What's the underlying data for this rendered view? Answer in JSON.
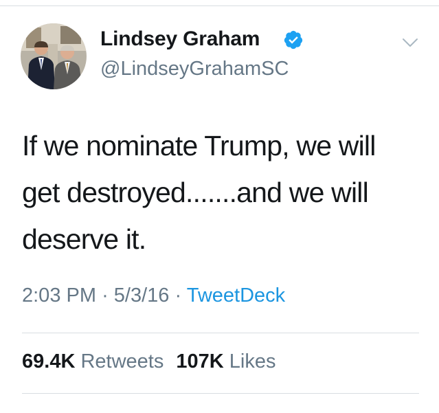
{
  "user": {
    "name": "Lindsey Graham",
    "handle": "@LindseyGrahamSC",
    "verified_color": "#1da1f2"
  },
  "tweet": {
    "text_lines": [
      "If we nominate Trump, we will",
      "get destroyed.......and we will",
      "deserve it."
    ],
    "time": "2:03 PM",
    "date": "5/3/16",
    "separator": "·",
    "source": "TweetDeck"
  },
  "stats": {
    "retweets_count": "69.4K",
    "retweets_label": "Retweets",
    "likes_count": "107K",
    "likes_label": "Likes"
  },
  "colors": {
    "link": "#1b95e0",
    "secondary_text": "#657786",
    "divider": "#d8dde1"
  }
}
